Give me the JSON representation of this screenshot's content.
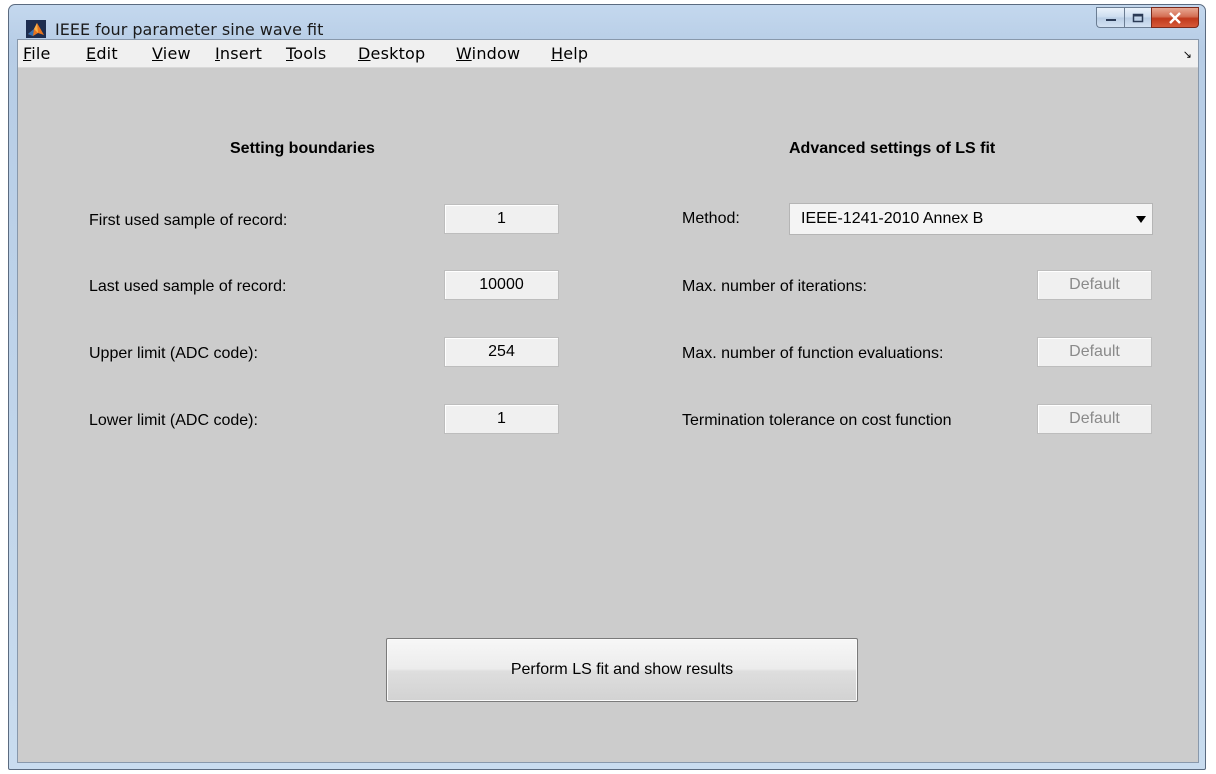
{
  "window": {
    "title": "IEEE four parameter sine wave fit",
    "icon": "matlab-logo-icon"
  },
  "menubar": {
    "items": [
      {
        "label": "File",
        "mnemonic": "F",
        "rest": "ile"
      },
      {
        "label": "Edit",
        "mnemonic": "E",
        "rest": "dit"
      },
      {
        "label": "View",
        "mnemonic": "V",
        "rest": "iew"
      },
      {
        "label": "Insert",
        "mnemonic": "I",
        "rest": "nsert"
      },
      {
        "label": "Tools",
        "mnemonic": "T",
        "rest": "ools"
      },
      {
        "label": "Desktop",
        "mnemonic": "D",
        "rest": "esktop"
      },
      {
        "label": "Window",
        "mnemonic": "W",
        "rest": "indow"
      },
      {
        "label": "Help",
        "mnemonic": "H",
        "rest": "elp"
      }
    ],
    "dock_icon": "↘"
  },
  "boundaries": {
    "heading": "Setting boundaries",
    "first_sample": {
      "label": "First used sample of record:",
      "value": "1"
    },
    "last_sample": {
      "label": "Last used sample of record:",
      "value": "10000"
    },
    "upper_limit": {
      "label": "Upper limit (ADC code):",
      "value": "254"
    },
    "lower_limit": {
      "label": "Lower limit (ADC code):",
      "value": "1"
    }
  },
  "advanced": {
    "heading": "Advanced settings of LS fit",
    "method": {
      "label": "Method:",
      "value": "IEEE-1241-2010 Annex B"
    },
    "max_iterations": {
      "label": "Max. number of iterations:",
      "value": "Default"
    },
    "max_evaluations": {
      "label": "Max. number of function evaluations:",
      "value": "Default"
    },
    "tolerance": {
      "label": "Termination tolerance on cost function",
      "value": "Default"
    }
  },
  "actions": {
    "perform": "Perform LS fit and show results"
  },
  "colors": {
    "panel": "#cccccc",
    "titlebar": "#c4d8ee",
    "close_button": "#c0391c"
  }
}
